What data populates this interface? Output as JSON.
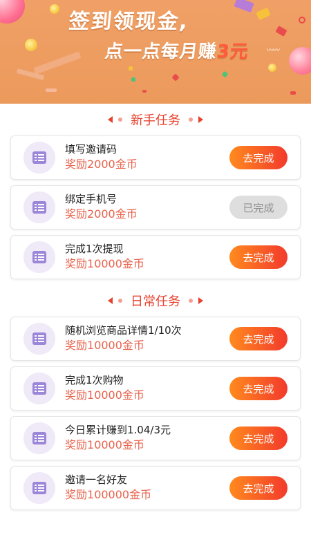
{
  "banner": {
    "line1": "签到领现金,",
    "line2_prefix": "点一点每月赚",
    "line2_highlight": "3元"
  },
  "sections": [
    {
      "title": "新手任务",
      "tasks": [
        {
          "name": "填写邀请码",
          "reward_prefix": "奖励",
          "reward": "2000金币",
          "button": "去完成",
          "status": "todo"
        },
        {
          "name": "绑定手机号",
          "reward_prefix": "奖励",
          "reward": "2000金币",
          "button": "已完成",
          "status": "done"
        },
        {
          "name": "完成1次提现",
          "reward_prefix": "奖励",
          "reward": "10000金币",
          "button": "去完成",
          "status": "todo"
        }
      ]
    },
    {
      "title": "日常任务",
      "tasks": [
        {
          "name": "随机浏览商品详情1/10次",
          "reward_prefix": "奖励",
          "reward": "10000金币",
          "button": "去完成",
          "status": "todo"
        },
        {
          "name": "完成1次购物",
          "reward_prefix": "奖励",
          "reward": "10000金币",
          "button": "去完成",
          "status": "todo"
        },
        {
          "name": "今日累计赚到1.04/3元",
          "reward_prefix": "奖励",
          "reward": "10000金币",
          "button": "去完成",
          "status": "todo"
        },
        {
          "name": "邀请一名好友",
          "reward_prefix": "奖励",
          "reward": "100000金币",
          "button": "去完成",
          "status": "todo"
        }
      ]
    }
  ],
  "icons": {
    "task": "task-list-icon"
  },
  "colors": {
    "accent": "#e8402e",
    "reward": "#e8634d",
    "button_gradient_start": "#ff8a1e",
    "button_gradient_end": "#f23a2c",
    "done_button": "#dedede",
    "banner": "#ec9a5c",
    "icon_bg": "#efe9f8",
    "icon_fg": "#9b86d8"
  }
}
